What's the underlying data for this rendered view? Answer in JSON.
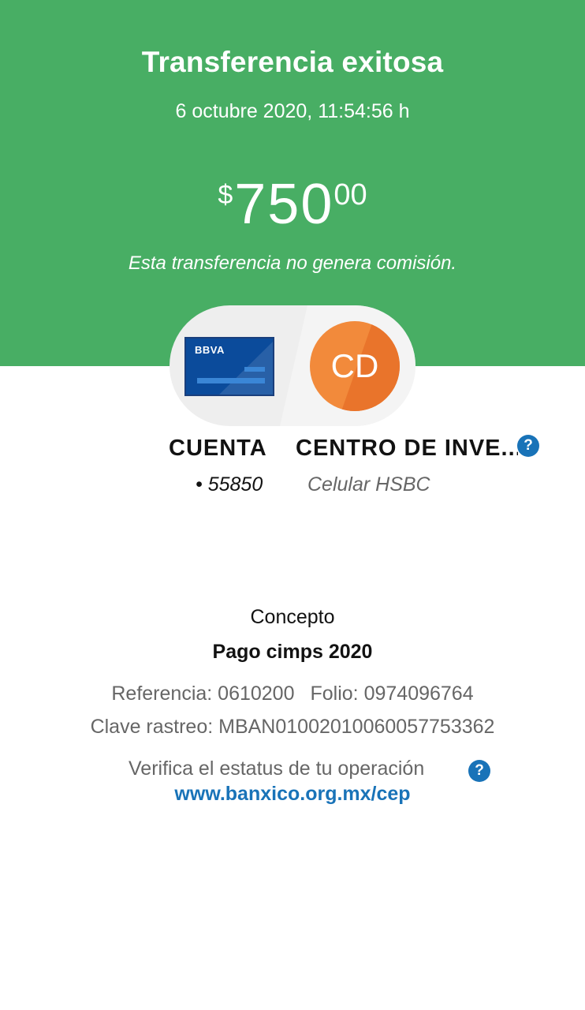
{
  "header": {
    "title": "Transferencia exitosa",
    "datetime": "6 octubre 2020, 11:54:56 h",
    "amount": {
      "currency": "$",
      "integer": "750",
      "decimals": "00"
    },
    "fee_note": "Esta transferencia no genera comisión."
  },
  "source": {
    "card_logo": "BBVA",
    "label": "CUENTA",
    "sub": "• 55850"
  },
  "destination": {
    "avatar_initials": "CD",
    "label": "CENTRO DE INVE...",
    "sub": "Celular HSBC",
    "help_icon": "?"
  },
  "details": {
    "concept_label": "Concepto",
    "concept_value": "Pago cimps 2020",
    "reference": "Referencia: 0610200",
    "folio": "Folio: 0974096764",
    "trace_key": "Clave rastreo: MBAN01002010060057753362",
    "verify_text": "Verifica el estatus de tu operación",
    "verify_help_icon": "?",
    "link": "www.banxico.org.mx/cep"
  },
  "colors": {
    "success_green": "#48AE64",
    "brand_blue": "#1973B8",
    "card_blue": "#0B4B9B",
    "avatar_orange": "#F28A3B"
  }
}
